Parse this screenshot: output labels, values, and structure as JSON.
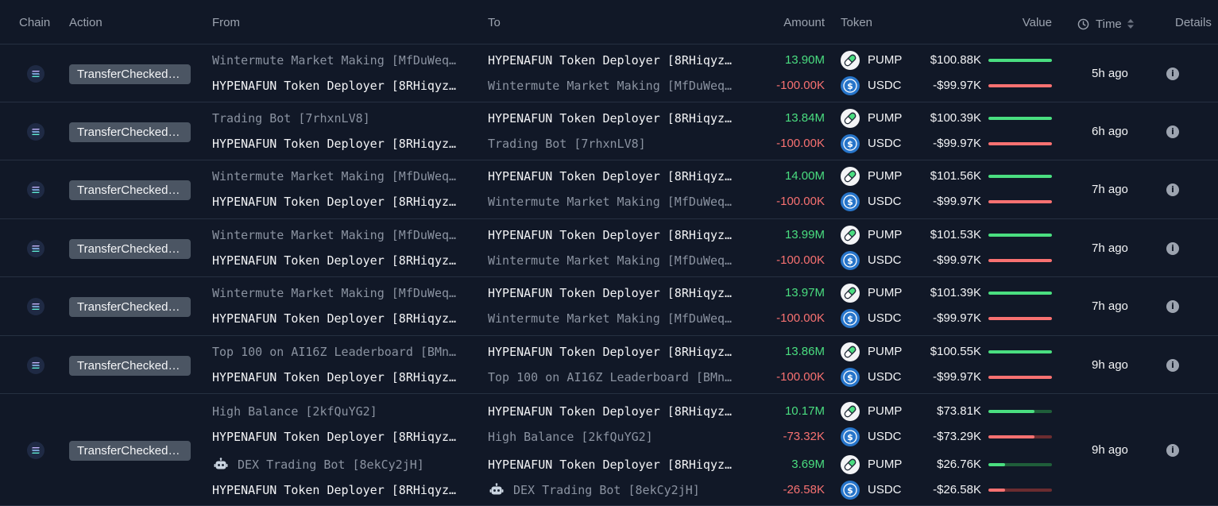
{
  "header": {
    "chain": "Chain",
    "action": "Action",
    "from": "From",
    "to": "To",
    "amount": "Amount",
    "token": "Token",
    "value": "Value",
    "time": "Time",
    "details": "Details"
  },
  "colors": {
    "background": "#111827",
    "positive": "#4ade80",
    "negative": "#f87171",
    "badge": "#4b5563",
    "usdc": "#2775ca"
  },
  "icons": {
    "chain": "solana-icon",
    "pump": "pump-pill-icon",
    "usdc": "usdc-icon",
    "bot": "robot-icon",
    "info": "info-icon",
    "time": "clock-icon",
    "sort": "sort-icon"
  },
  "rows": [
    {
      "action": "TransferChecked…",
      "time": "5h ago",
      "transfers": [
        {
          "from": "Wintermute Market Making [MfDuWeq…",
          "to": "HYPENAFUN Token Deployer [8RHiqyz…",
          "amount": "13.90M",
          "token": "PUMP",
          "value": "$100.88K",
          "bar": 1.0
        },
        {
          "from": "HYPENAFUN Token Deployer [8RHiqyz…",
          "to": "Wintermute Market Making [MfDuWeq…",
          "amount": "-100.00K",
          "token": "USDC",
          "value": "-$99.97K",
          "bar": 1.0
        }
      ]
    },
    {
      "action": "TransferChecked…",
      "time": "6h ago",
      "transfers": [
        {
          "from": "Trading Bot [7rhxnLV8]",
          "to": "HYPENAFUN Token Deployer [8RHiqyz…",
          "amount": "13.84M",
          "token": "PUMP",
          "value": "$100.39K",
          "bar": 1.0
        },
        {
          "from": "HYPENAFUN Token Deployer [8RHiqyz…",
          "to": "Trading Bot [7rhxnLV8]",
          "amount": "-100.00K",
          "token": "USDC",
          "value": "-$99.97K",
          "bar": 1.0
        }
      ]
    },
    {
      "action": "TransferChecked…",
      "time": "7h ago",
      "transfers": [
        {
          "from": "Wintermute Market Making [MfDuWeq…",
          "to": "HYPENAFUN Token Deployer [8RHiqyz…",
          "amount": "14.00M",
          "token": "PUMP",
          "value": "$101.56K",
          "bar": 1.0
        },
        {
          "from": "HYPENAFUN Token Deployer [8RHiqyz…",
          "to": "Wintermute Market Making [MfDuWeq…",
          "amount": "-100.00K",
          "token": "USDC",
          "value": "-$99.97K",
          "bar": 1.0
        }
      ]
    },
    {
      "action": "TransferChecked…",
      "time": "7h ago",
      "transfers": [
        {
          "from": "Wintermute Market Making [MfDuWeq…",
          "to": "HYPENAFUN Token Deployer [8RHiqyz…",
          "amount": "13.99M",
          "token": "PUMP",
          "value": "$101.53K",
          "bar": 1.0
        },
        {
          "from": "HYPENAFUN Token Deployer [8RHiqyz…",
          "to": "Wintermute Market Making [MfDuWeq…",
          "amount": "-100.00K",
          "token": "USDC",
          "value": "-$99.97K",
          "bar": 1.0
        }
      ]
    },
    {
      "action": "TransferChecked…",
      "time": "7h ago",
      "transfers": [
        {
          "from": "Wintermute Market Making [MfDuWeq…",
          "to": "HYPENAFUN Token Deployer [8RHiqyz…",
          "amount": "13.97M",
          "token": "PUMP",
          "value": "$101.39K",
          "bar": 1.0
        },
        {
          "from": "HYPENAFUN Token Deployer [8RHiqyz…",
          "to": "Wintermute Market Making [MfDuWeq…",
          "amount": "-100.00K",
          "token": "USDC",
          "value": "-$99.97K",
          "bar": 1.0
        }
      ]
    },
    {
      "action": "TransferChecked…",
      "time": "9h ago",
      "transfers": [
        {
          "from": "Top 100 on AI16Z Leaderboard [BMn…",
          "to": "HYPENAFUN Token Deployer [8RHiqyz…",
          "amount": "13.86M",
          "token": "PUMP",
          "value": "$100.55K",
          "bar": 1.0
        },
        {
          "from": "HYPENAFUN Token Deployer [8RHiqyz…",
          "to": "Top 100 on AI16Z Leaderboard [BMn…",
          "amount": "-100.00K",
          "token": "USDC",
          "value": "-$99.97K",
          "bar": 1.0
        }
      ]
    },
    {
      "action": "TransferChecked…",
      "time": "9h ago",
      "transfers": [
        {
          "from": "High Balance [2kfQuYG2]",
          "to": "HYPENAFUN Token Deployer [8RHiqyz…",
          "amount": "10.17M",
          "token": "PUMP",
          "value": "$73.81K",
          "bar": 0.73
        },
        {
          "from": "HYPENAFUN Token Deployer [8RHiqyz…",
          "to": "High Balance [2kfQuYG2]",
          "amount": "-73.32K",
          "token": "USDC",
          "value": "-$73.29K",
          "bar": 0.73
        },
        {
          "from": "DEX Trading Bot [8ekCy2jH]",
          "from_bot": true,
          "to": "HYPENAFUN Token Deployer [8RHiqyz…",
          "amount": "3.69M",
          "token": "PUMP",
          "value": "$26.76K",
          "bar": 0.26
        },
        {
          "from": "HYPENAFUN Token Deployer [8RHiqyz…",
          "to": "DEX Trading Bot [8ekCy2jH]",
          "to_bot": true,
          "amount": "-26.58K",
          "token": "USDC",
          "value": "-$26.58K",
          "bar": 0.26
        }
      ]
    }
  ]
}
